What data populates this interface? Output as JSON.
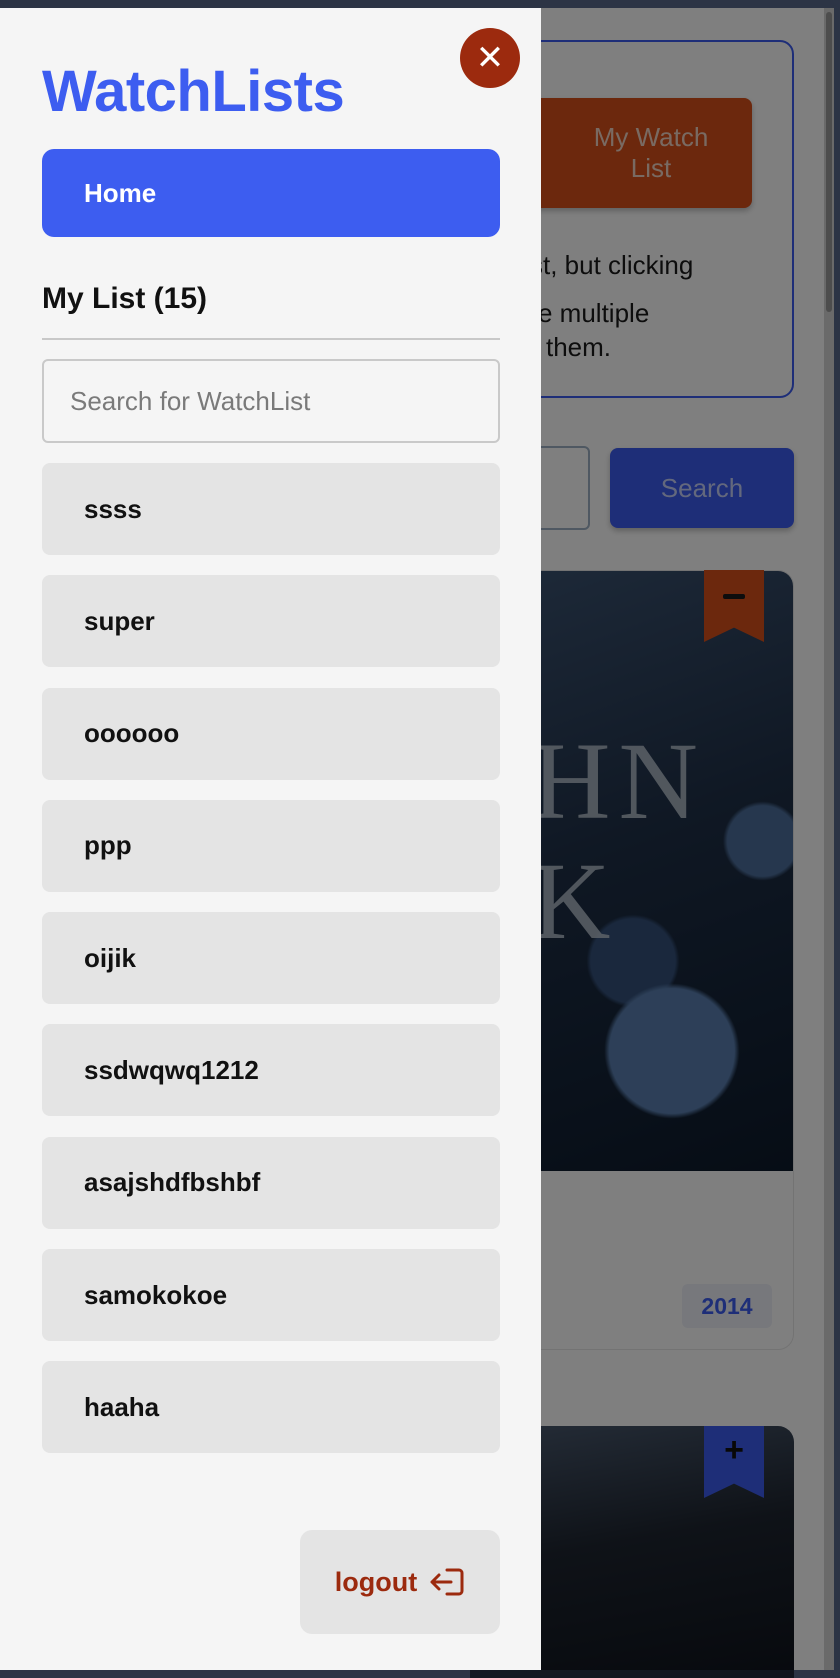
{
  "drawer": {
    "title": "WatchLists",
    "home_label": "Home",
    "list_heading": "My List (15)",
    "search_placeholder": "Search for WatchList",
    "items": [
      {
        "label": "ssss"
      },
      {
        "label": "super"
      },
      {
        "label": "oooooo"
      },
      {
        "label": "ppp"
      },
      {
        "label": "oijik"
      },
      {
        "label": "ssdwqwq1212"
      },
      {
        "label": "asajshdfbshbf"
      },
      {
        "label": "samokokoe"
      },
      {
        "label": "haaha"
      }
    ],
    "logout_label": "logout",
    "close_symbol": "✕"
  },
  "background": {
    "my_watch_list_label": "My Watch List",
    "info_line1": "st, but clicking",
    "info_line2": "e multiple",
    "info_line3": "them.",
    "search_button": "Search",
    "poster_text": "HN\nK",
    "year": "2014",
    "add_symbol": "+"
  },
  "colors": {
    "accent": "#3d5df0",
    "danger": "#9c2a0e",
    "orange": "#d8501a"
  },
  "icons": {
    "close": "close-icon",
    "logout": "logout-icon",
    "remove": "minus-icon",
    "add": "plus-icon"
  }
}
